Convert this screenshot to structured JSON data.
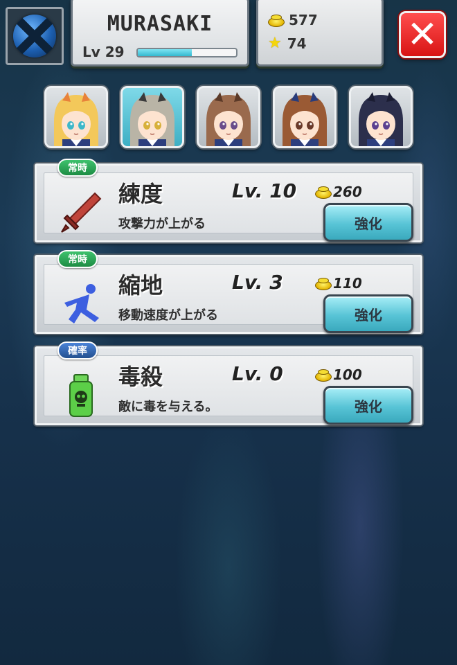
{
  "player": {
    "name": "MURASAKI",
    "level_label": "Lv 29",
    "exp_fraction": 0.55
  },
  "currency": {
    "coins": "577",
    "stars": "74"
  },
  "characters": [
    {
      "id": "char-1",
      "hair": "#f3c85a",
      "accent": "#e8823a",
      "eyes": "#3db7c9",
      "selected": false
    },
    {
      "id": "char-2",
      "hair": "#b9b4a6",
      "accent": "#3a3a3a",
      "eyes": "#d7b03a",
      "selected": true
    },
    {
      "id": "char-3",
      "hair": "#9a6a4d",
      "accent": "#5c3a28",
      "eyes": "#6a4c8a",
      "selected": false
    },
    {
      "id": "char-4",
      "hair": "#9a5a34",
      "accent": "#2a3c7a",
      "eyes": "#6a3a2a",
      "selected": false
    },
    {
      "id": "char-5",
      "hair": "#2c2f4c",
      "accent": "#1b1d33",
      "eyes": "#5a3f8f",
      "selected": false
    }
  ],
  "skills": [
    {
      "badge": "常時",
      "badge_color": "green",
      "icon": "sword-icon",
      "name": "練度",
      "level": "Lv. 10",
      "cost": "260",
      "description": "攻撃力が上がる",
      "button": "強化"
    },
    {
      "badge": "常時",
      "badge_color": "green",
      "icon": "running-figure-icon",
      "name": "縮地",
      "level": "Lv. 3",
      "cost": "110",
      "description": "移動速度が上がる",
      "button": "強化"
    },
    {
      "badge": "確率",
      "badge_color": "blue",
      "icon": "poison-bottle-icon",
      "name": "毒殺",
      "level": "Lv. 0",
      "cost": "100",
      "description": "敵に毒を与える。",
      "button": "強化"
    }
  ],
  "close_label": "✕"
}
